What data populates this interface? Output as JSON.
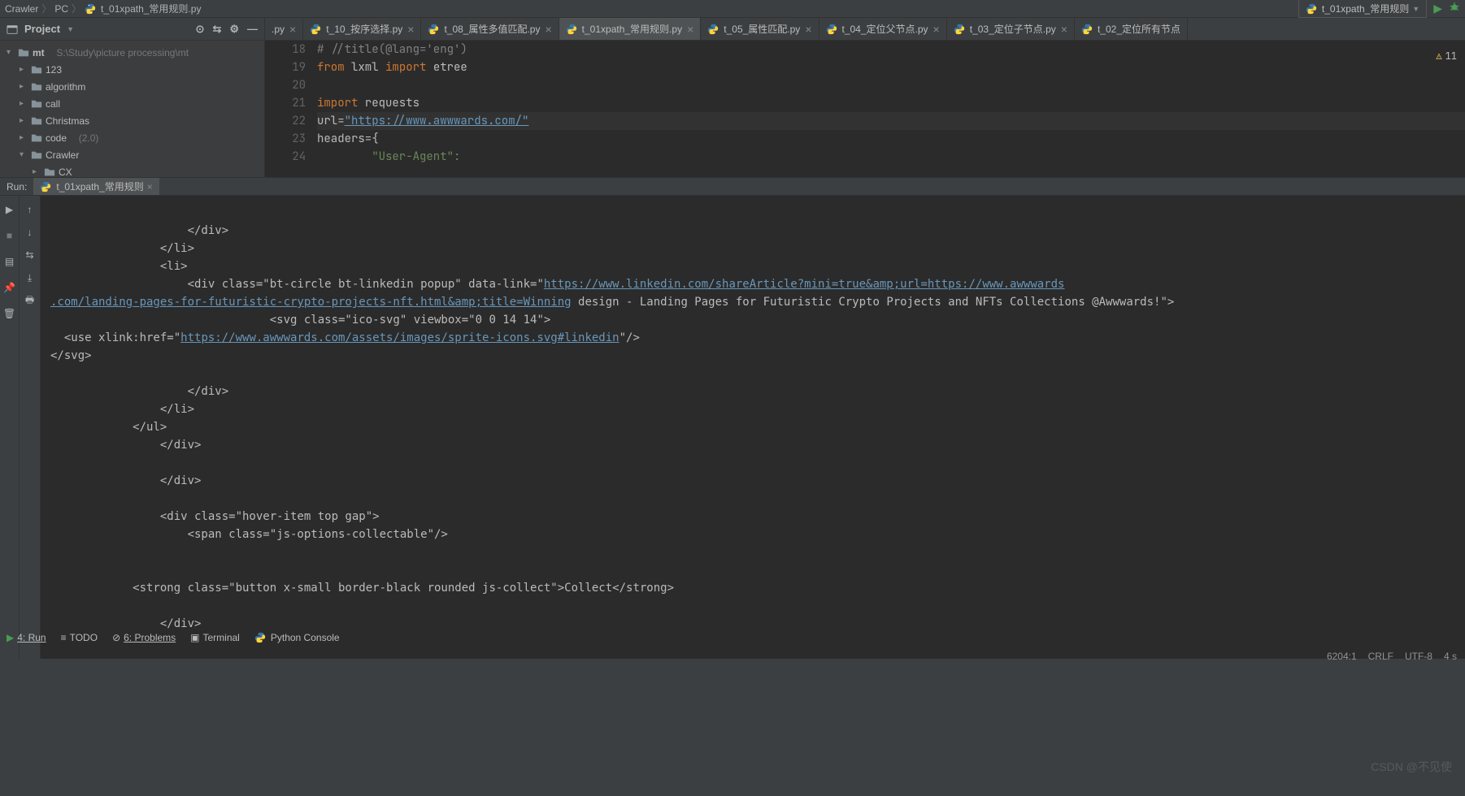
{
  "breadcrumb": {
    "p0": "Crawler",
    "p1": "PC",
    "p2": "t_01xpath_常用规则.py"
  },
  "runconfig": {
    "label": "t_01xpath_常用规则"
  },
  "project": {
    "header": "Project",
    "root": "mt",
    "root_path": "S:\\Study\\picture processing\\mt",
    "items": [
      "123",
      "algorithm",
      "call",
      "Christmas",
      "Crawler",
      "CX"
    ],
    "code_label": "code",
    "code_ver": "(2.0)"
  },
  "tabs": {
    "t0": ".py",
    "t1": "t_10_按序选择.py",
    "t2": "t_08_属性多值匹配.py",
    "t3": "t_01xpath_常用规则.py",
    "t4": "t_05_属性匹配.py",
    "t5": "t_04_定位父节点.py",
    "t6": "t_03_定位子节点.py",
    "t7": "t_02_定位所有节点"
  },
  "code": {
    "lineStart": 18,
    "l18": "# //title(@lang='eng')",
    "l19_a": "from",
    "l19_b": " lxml ",
    "l19_c": "import",
    "l19_d": " etree",
    "l21_a": "import",
    "l21_b": " requests",
    "l22_a": "url",
    "l22_b": "=",
    "l22_c": "\"https://www.awwwards.com/\"",
    "l23": "headers={",
    "l24": "        \"User-Agent\":"
  },
  "warnings": "11",
  "run": {
    "label": "Run:",
    "tab": "t_01xpath_常用规则"
  },
  "console": {
    "l1": "                    </div>",
    "l2": "                </li>",
    "l3": "                <li>",
    "l4a": "                    <div class=\"bt-circle bt-linkedin popup\" data-link=\"",
    "l4b": "https://www.linkedin.com/shareArticle?mini=true&amp;url=https://www.awwwards",
    "l5a": ".com/landing-pages-for-futuristic-crypto-projects-nft.html&amp;title=Winning",
    "l5b": " design - Landing Pages for Futuristic Crypto Projects and NFTs Collections @Awwwards!\">",
    "l6": "                                <svg class=\"ico-svg\" viewbox=\"0 0 14 14\">",
    "l7a": "  <use xlink:href=\"",
    "l7b": "https://www.awwwards.com/assets/images/sprite-icons.svg#linkedin",
    "l7c": "\"/>",
    "l8": "</svg>",
    "l10": "                    </div>",
    "l11": "                </li>",
    "l12": "            </ul>",
    "l13": "                </div>",
    "l15": "                </div>",
    "l17": "                <div class=\"hover-item top gap\">",
    "l18": "                    <span class=\"js-options-collectable\"/>",
    "l21": "            <strong class=\"button x-small border-black rounded js-collect\">Collect</strong>",
    "l23": "                </div>"
  },
  "bottom": {
    "run": "4: Run",
    "todo": "TODO",
    "problems": "6: Problems",
    "terminal": "Terminal",
    "pyconsole": "Python Console"
  },
  "status": {
    "pos": "6204:1",
    "ln": "CRLF",
    "enc": "UTF-8",
    "sp": "4 s"
  },
  "watermark": "CSDN @不见使"
}
